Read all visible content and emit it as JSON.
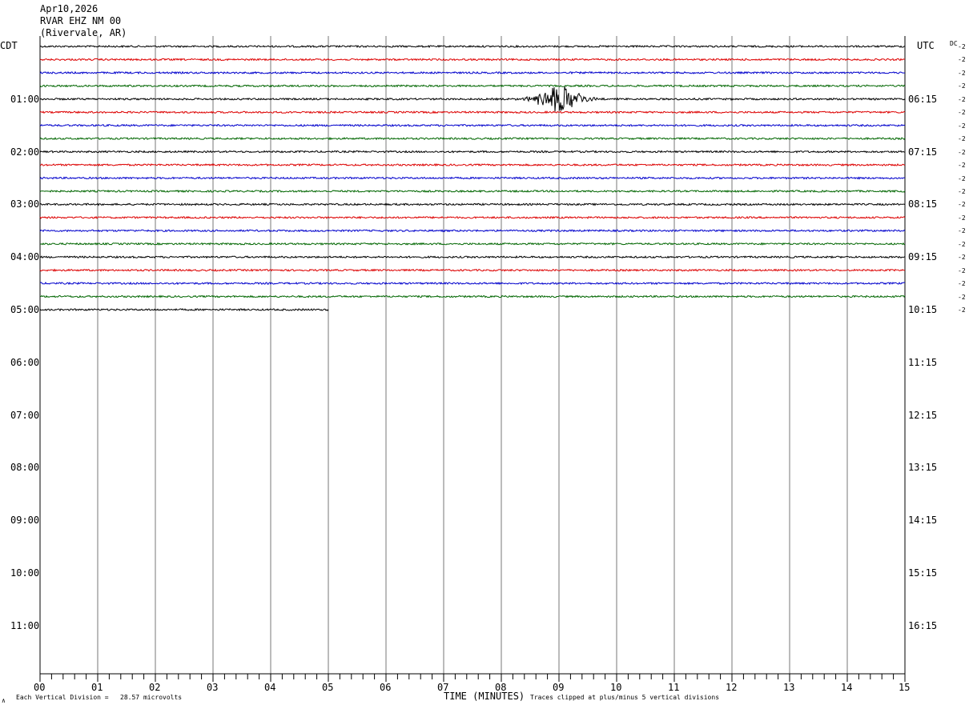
{
  "header": {
    "date": "Apr10,2026",
    "station": "RVAR EHZ NM 00",
    "location": "(Rivervale, AR)"
  },
  "left_zone_label": "CDT",
  "right_zone_label": "UTC",
  "dc_label": "DC",
  "footer": {
    "scale_note": "Each Vertical Division =   28.57 microvolts",
    "xlabel": "TIME (MINUTES)",
    "clip_note": "Traces clipped at plus/minus 5 vertical divisions",
    "corner_mark": "∧"
  },
  "chart_data": {
    "type": "line",
    "title": "RVAR EHZ NM 00",
    "xlabel": "TIME (MINUTES)",
    "ylabel": "",
    "x_ticks": [
      "00",
      "01",
      "02",
      "03",
      "04",
      "05",
      "06",
      "07",
      "08",
      "09",
      "10",
      "11",
      "12",
      "13",
      "14",
      "15"
    ],
    "xlim": [
      0,
      15
    ],
    "left_hour_labels": [
      "01:00",
      "02:00",
      "03:00",
      "04:00",
      "05:00",
      "06:00",
      "07:00",
      "08:00",
      "09:00",
      "10:00",
      "11:00"
    ],
    "right_hour_labels": [
      "06:15",
      "07:15",
      "08:15",
      "09:15",
      "10:15",
      "11:15",
      "12:15",
      "13:15",
      "14:15",
      "15:15",
      "16:15"
    ],
    "trace_colors": [
      "#000000",
      "#dd0000",
      "#0000cc",
      "#006600"
    ],
    "traces_per_hour": 4,
    "trace_minutes": 15,
    "num_full_traces": 20,
    "last_trace_end_minute": 5,
    "dc_offsets": [
      "-2",
      "-2",
      "-2",
      "-2",
      "-2",
      "-2",
      "-2",
      "-2",
      "-2",
      "-2",
      "-2",
      "-2",
      "-2",
      "-2",
      "-2",
      "-2",
      "-2",
      "-2",
      "-2",
      "-2",
      "-2"
    ],
    "events": [
      {
        "trace_index": 4,
        "center_minute": 9.0,
        "amplitude_divisions": 5,
        "duration_minutes": 1.8
      }
    ],
    "grid": true
  }
}
